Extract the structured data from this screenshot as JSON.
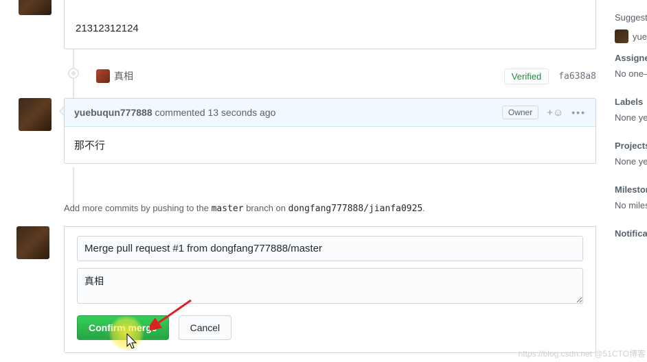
{
  "comment1": {
    "body": "21312312124"
  },
  "commit": {
    "name": "真相",
    "badge": "Verified",
    "sha": "fa638a8"
  },
  "comment2": {
    "author": "yuebuqun777888",
    "action": "commented",
    "time": "13 seconds ago",
    "owner_badge": "Owner",
    "body": "那不行"
  },
  "push_hint": {
    "prefix": "Add more commits by pushing to the ",
    "branch": "master",
    "mid": " branch on ",
    "repo": "dongfang777888/jianfa0925",
    "suffix": "."
  },
  "merge": {
    "title_value": "Merge pull request #1 from dongfang777888/master",
    "desc_value": "真相",
    "confirm_label": "Confirm merge",
    "cancel_label": "Cancel"
  },
  "sidebar": {
    "suggest_label": "Suggest",
    "suggested_user": "yue",
    "assignees_label": "Assignees",
    "assignees_value": "No one—",
    "labels_label": "Labels",
    "labels_value": "None ye",
    "projects_label": "Projects",
    "projects_value": "None ye",
    "milestone_label": "Milestone",
    "milestone_value": "No miles",
    "notifications_label": "Notifications"
  },
  "watermark": "https://blog.csdn.net @51CTO博客"
}
